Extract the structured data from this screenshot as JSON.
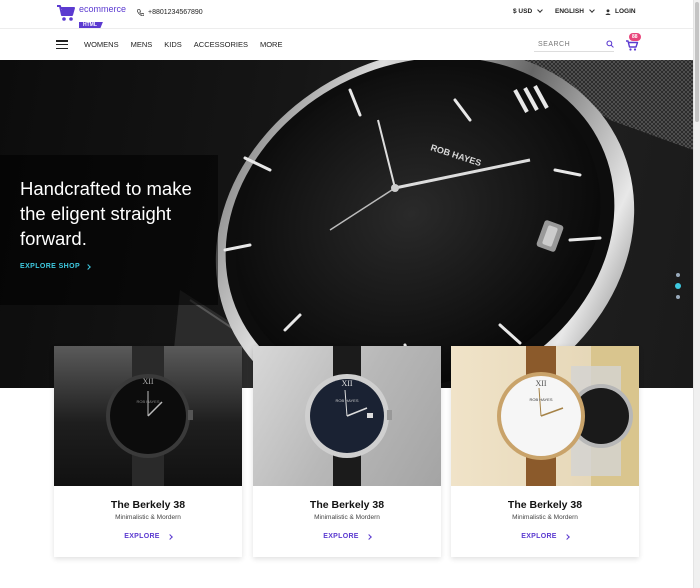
{
  "brand": {
    "logo_text": "ecommerce",
    "logo_tag": "HTML",
    "accent": "#5b3ad0",
    "highlight": "#3ec9e0",
    "badge_color": "#e8457b"
  },
  "topbar": {
    "phone_icon": "phone-icon",
    "phone": "+8801234567890",
    "currency": "$ USD",
    "language": "ENGLISH",
    "login": "LOGIN"
  },
  "nav": {
    "menu_icon": "hamburger-icon",
    "items": [
      "WOMENS",
      "MENS",
      "KIDS",
      "ACCESSORIES",
      "MORE"
    ],
    "search_placeholder": "SEARCH",
    "cart_count": "88"
  },
  "hero": {
    "title": "Handcrafted to make the eligent straight forward.",
    "cta": "EXPLORE SHOP",
    "watch_brand": "ROB HAYES",
    "slides_total": 3,
    "active_slide": 2
  },
  "products": [
    {
      "title": "The Berkely 38",
      "subtitle": "Minimalistic & Mordern",
      "cta": "EXPLORE",
      "watch_brand": "ROB HAYES"
    },
    {
      "title": "The Berkely 38",
      "subtitle": "Minimalistic & Mordern",
      "cta": "EXPLORE",
      "watch_brand": "ROB HAYES"
    },
    {
      "title": "The Berkely 38",
      "subtitle": "Minimalistic & Mordern",
      "cta": "EXPLORE",
      "watch_brand": "ROB HAYES"
    }
  ]
}
